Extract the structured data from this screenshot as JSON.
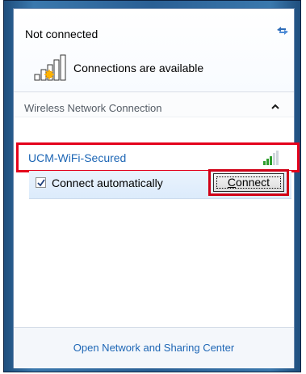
{
  "status": {
    "title": "Not connected",
    "subtitle": "Connections are available",
    "refresh_icon": "refresh-icon",
    "signal_icon": "signal-warning-icon"
  },
  "section": {
    "title": "Wireless Network Connection",
    "toggle_icon": "chevron-up-icon"
  },
  "network": {
    "name": "UCM-WiFi-Secured",
    "signal_icon": "wifi-signal-icon",
    "connect_automatically_label": "Connect automatically",
    "connect_automatically_checked": true,
    "connect_button_label": "Connect"
  },
  "footer": {
    "link": "Open Network and Sharing Center"
  },
  "colors": {
    "link": "#1d66b5",
    "highlight_border": "#e4001b",
    "selected_row": "#dcebfb"
  }
}
